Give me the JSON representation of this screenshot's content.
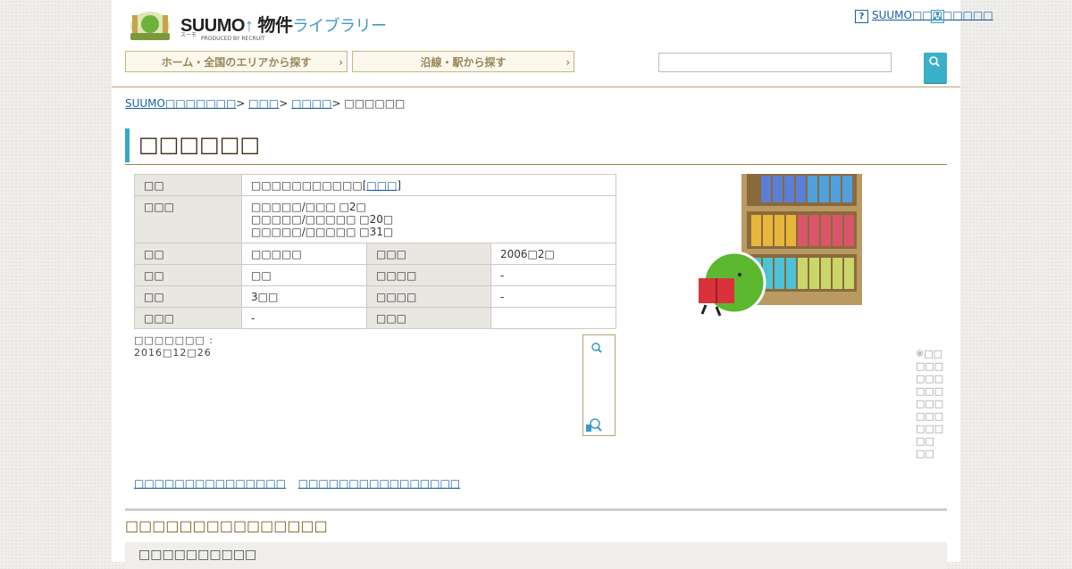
{
  "header": {
    "logo_text": "SUUMO",
    "logo_jp": "物件",
    "logo_library": "ライブラリー",
    "logo_kana": "スーモ",
    "produced_by": "PRODUCED BY RECRUIT",
    "help_link": "SUUMO□□□□□□□□",
    "search_placeholder": ""
  },
  "nav": {
    "area_button": "ホーム・全国のエリアから探す",
    "station_button": "沿線・駅から探す"
  },
  "breadcrumb": {
    "home": "SUUMO□□□□□□□",
    "level1": "□□□",
    "level2": "□□□□",
    "current": "□□□□□□"
  },
  "page_title": "□□□□□□",
  "info_table": {
    "address_label": "□□",
    "address_value": "□□□□□□□□□□□[",
    "address_link": "□□□",
    "address_tail": "]",
    "access_label": "□□□",
    "access_lines": [
      "□□□□□/□□□ □2□",
      "□□□□□/□□□□□ □20□",
      "□□□□□/□□□□□ □31□"
    ],
    "rows": [
      {
        "l1": "□□",
        "v1": "□□□□□",
        "l2": "□□□",
        "v2": "2006□2□"
      },
      {
        "l1": "□□",
        "v1": "□□",
        "l2": "□□□□",
        "v2": "-"
      },
      {
        "l1": "□□",
        "v1": "3□□",
        "l2": "□□□□",
        "v2": "-"
      },
      {
        "l1": "□□□",
        "v1": "-",
        "l2": "□□□",
        "v2": ""
      }
    ]
  },
  "updated_label": "□□□□□□□ :",
  "updated_date": "2016□12□26",
  "note_lines": [
    "※□□",
    "□□□",
    "□□□",
    "□□□",
    "□□□",
    "□□□",
    "□□□",
    "□□",
    "□□"
  ],
  "bottom_links": {
    "link1": "□□□□□□□□□□□□□□□",
    "link2": "□□□□□□□□□□□□□□□□"
  },
  "section_title": "□□□□□□□□□□□□□□□",
  "panel_title": "□□□□□□□□□□",
  "colors": {
    "accent": "#3aa6c4",
    "gold": "#b9a470",
    "link": "#1a5fa6"
  },
  "icons": [
    "help-icon",
    "sitemap-icon",
    "search-icon",
    "zoom-in-icon",
    "zoom-out-icon"
  ]
}
